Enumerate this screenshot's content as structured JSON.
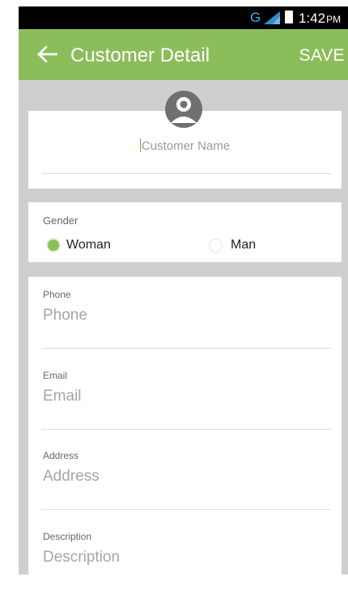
{
  "status_bar": {
    "network": "G",
    "time": "1:42",
    "ampm": "PM",
    "icons": [
      "signal-icon",
      "battery-icon"
    ]
  },
  "app_bar": {
    "back_icon": "arrow-left-icon",
    "title": "Customer Detail",
    "save_label": "SAVE",
    "color": "#8cbd5b"
  },
  "customer": {
    "avatar_icon": "person-avatar-icon",
    "name_placeholder": "Customer Name",
    "name_value": ""
  },
  "gender": {
    "label": "Gender",
    "options": [
      {
        "label": "Woman",
        "selected": true
      },
      {
        "label": "Man",
        "selected": false
      }
    ]
  },
  "fields": [
    {
      "label": "Phone",
      "placeholder": "Phone",
      "value": ""
    },
    {
      "label": "Email",
      "placeholder": "Email",
      "value": ""
    },
    {
      "label": "Address",
      "placeholder": "Address",
      "value": ""
    },
    {
      "label": "Description",
      "placeholder": "Description",
      "value": ""
    }
  ]
}
